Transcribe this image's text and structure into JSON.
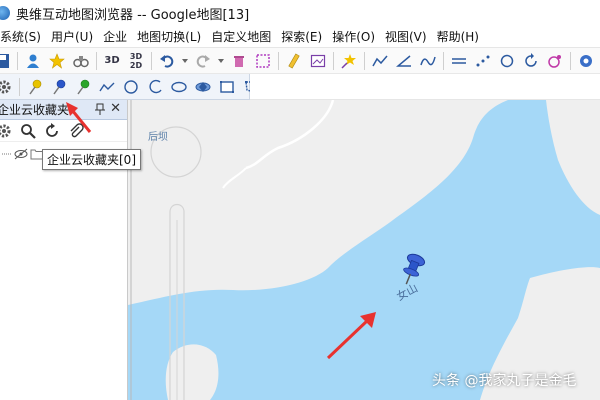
{
  "window": {
    "title": "奥维互动地图浏览器 -- Google地图[13]"
  },
  "menu": {
    "items": [
      {
        "label": "系统(S)"
      },
      {
        "label": "用户(U)"
      },
      {
        "label": "企业"
      },
      {
        "label": "地图切换(L)"
      },
      {
        "label": "自定义地图"
      },
      {
        "label": "探索(E)"
      },
      {
        "label": "操作(O)"
      },
      {
        "label": "视图(V)"
      },
      {
        "label": "帮助(H)"
      }
    ]
  },
  "toolbar": {
    "btn_3d": "3D",
    "btn_3d2d_top": "3D",
    "btn_3d2d_bottom": "2D"
  },
  "panel": {
    "title": "企业云收藏夹",
    "pin": "ᵖ",
    "close": "✕"
  },
  "tree": {
    "root_label": "企业云收藏夹[0]"
  },
  "tooltip": {
    "text": "企业云收藏夹[0]"
  },
  "map": {
    "labels": {
      "houba": "后坝",
      "nvshan": "女山"
    },
    "colors": {
      "water": "#a5d8f7",
      "land": "#efefef",
      "road": "#ffffff"
    }
  },
  "watermark": {
    "text": "头条 @我家丸子是金毛"
  },
  "accent": {
    "arrow": "#e8322f",
    "pin_blue": "#2b56c9",
    "pin_yellow": "#e8c400",
    "pin_green": "#2aa52a"
  }
}
